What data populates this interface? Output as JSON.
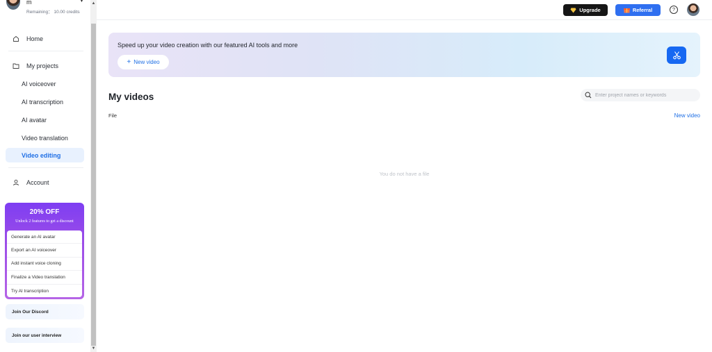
{
  "user": {
    "name": "m",
    "credits": "Remaining： 10.00 credits"
  },
  "nav": {
    "home": "Home",
    "projects": "My projects",
    "sub_items": [
      "AI voiceover",
      "AI transcription",
      "AI avatar",
      "Video translation",
      "Video editing"
    ],
    "active_sub": "Video editing",
    "account": "Account"
  },
  "promo": {
    "title": "20% OFF",
    "subtitle": "Unlock 2 features to get a discount",
    "items": [
      "Generate an AI avatar",
      "Export an AI voiceover",
      "Add instant voice cloning",
      "Finalize a Video translation",
      "Try AI transcription"
    ]
  },
  "side_cards": [
    "Join Our Discord",
    "Join our user interview"
  ],
  "header": {
    "upgrade_label": "Upgrade",
    "referral_label": "Referral",
    "help": "?"
  },
  "banner": {
    "text": "Speed up your video creation with our featured AI tools and more",
    "button_label": "New video"
  },
  "main": {
    "title": "My videos",
    "search_placeholder": "Enter project names or keywords",
    "file_label": "File",
    "new_video_link": "New video",
    "empty_message": "You do not have a file"
  },
  "colors": {
    "accent": "#1f6fe5",
    "active_bg": "#e8f1fe",
    "promo": "#8a44ee",
    "upgrade_bg": "#161616",
    "referral_bg": "#2f6ff0"
  },
  "icons": [
    "home-icon",
    "folder-icon",
    "user-icon",
    "diamond-icon",
    "gift-icon",
    "help-icon",
    "search-icon",
    "plus-icon",
    "scissors-icon"
  ]
}
